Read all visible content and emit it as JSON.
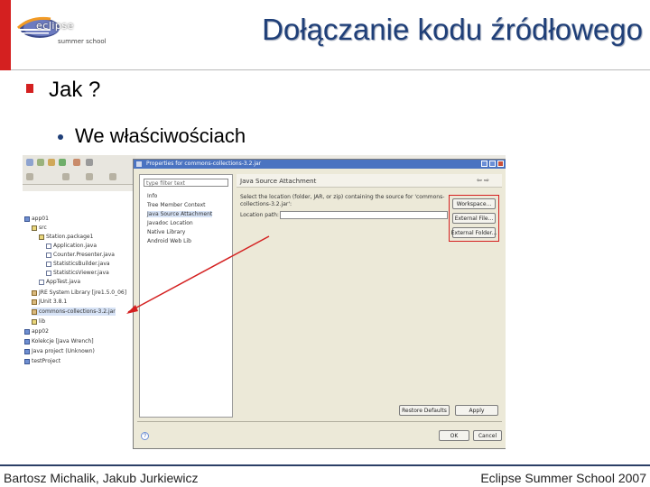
{
  "slide": {
    "title": "Dołączanie kodu źródłowego",
    "bullet1": "Jak ?",
    "bullet2": "We właściwościach"
  },
  "logo": {
    "word": "eclipse",
    "subtitle": "summer school"
  },
  "footer": {
    "authors": "Bartosz Michalik, Jakub Jurkiewicz",
    "event": "Eclipse Summer School 2007"
  },
  "screenshot": {
    "tree": [
      "app01",
      "src",
      "Station.package1",
      "Application.java",
      "Counter.Presenter.java",
      "StatisticsBuilder.java",
      "StatisticsViewer.java",
      "AppTest.java",
      "JRE System Library [jre1.5.0_06]",
      "JUnit 3.8.1",
      "commons-collections-3.2.jar",
      "lib",
      "app02",
      "Kolekcje [Java Wrench]",
      "Java project (Unknown)",
      "testProject"
    ],
    "dialog": {
      "title": "Properties for commons-collections-3.2.jar",
      "filter": "type filter text",
      "nav": [
        "Info",
        "Tree Member Context",
        "Java Source Attachment",
        "Javadoc Location",
        "Native Library",
        "Android Web Lib"
      ],
      "page_heading": "Java Source Attachment",
      "description": "Select the location (folder, JAR, or zip) containing the source for 'commons-collections-3.2.jar':",
      "location_label": "Location path:",
      "buttons": {
        "workspace": "Workspace...",
        "external_file": "External File...",
        "external_folder": "External Folder...",
        "restore_defaults": "Restore Defaults",
        "apply": "Apply",
        "ok": "OK",
        "cancel": "Cancel"
      }
    }
  },
  "colors": {
    "accent_red": "#d42020",
    "title_blue": "#1f3f78",
    "dialog_bg": "#ece9d8",
    "titlebar_blue": "#4a73c1"
  }
}
